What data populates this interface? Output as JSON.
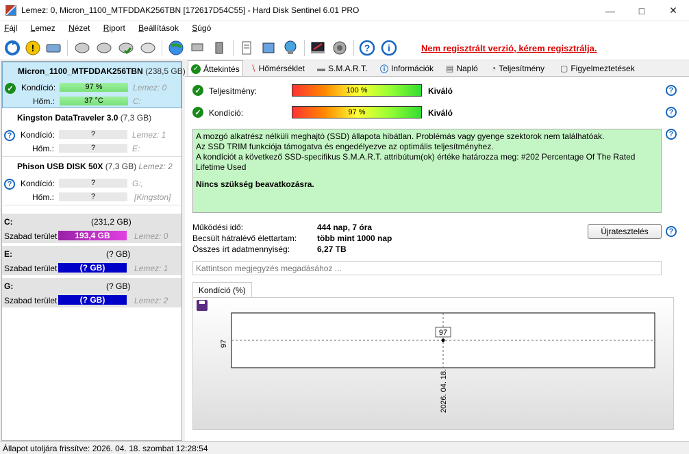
{
  "window": {
    "title": "Lemez: 0, Micron_1100_MTFDDAK256TBN [172617D54C55]  -  Hard Disk Sentinel 6.01 PRO"
  },
  "menu": [
    "Fájl",
    "Lemez",
    "Nézet",
    "Riport",
    "Beállítások",
    "Súgó"
  ],
  "toolbar": {
    "register_link": "Nem regisztrált verzió, kérem regisztrálja."
  },
  "disks": [
    {
      "name": "Micron_1100_MTFDDAK256TBN",
      "size": "(238,5 GB)",
      "condition_label": "Kondíció:",
      "condition": "97 %",
      "condition_ghost": "Lemez: 0",
      "temp_label": "Hőm.:",
      "temp": "37 °C",
      "temp_ghost": "C:"
    },
    {
      "name": "Kingston DataTraveler 3.0",
      "size": "(7,3 GB)",
      "condition_label": "Kondíció:",
      "condition": "?",
      "condition_ghost": "Lemez: 1",
      "temp_label": "Hőm.:",
      "temp": "?",
      "temp_ghost": "E:"
    },
    {
      "name": "Phison  USB DISK 50X",
      "size": "(7,3 GB)",
      "disk_ghost": "Lemez: 2",
      "condition_label": "Kondíció:",
      "condition": "?",
      "condition_ghost": "G:,",
      "temp_label": "Hőm.:",
      "temp": "?",
      "temp_ghost": "[Kingston]"
    }
  ],
  "volumes": [
    {
      "letter": "C:",
      "size": "(231,2 GB)",
      "free_label": "Szabad terület",
      "free": "193,4 GB",
      "ghost": "Lemez: 0"
    },
    {
      "letter": "E:",
      "size": "(? GB)",
      "free_label": "Szabad terület",
      "free": "(? GB)",
      "ghost": "Lemez: 1"
    },
    {
      "letter": "G:",
      "size": "(? GB)",
      "free_label": "Szabad terület",
      "free": "(? GB)",
      "ghost": "Lemez: 2"
    }
  ],
  "tabs": [
    "Áttekintés",
    "Hőmérséklet",
    "S.M.A.R.T.",
    "Információk",
    "Napló",
    "Teljesítmény",
    "Figyelmeztetések"
  ],
  "overview": {
    "performance_label": "Teljesítmény:",
    "performance_value": "100 %",
    "performance_rating": "Kiváló",
    "condition_label": "Kondíció:",
    "condition_value": "97 %",
    "condition_rating": "Kiváló",
    "status_lines": [
      "A mozgó alkatrész nélküli meghajtó (SSD) állapota hibátlan. Problémás vagy gyenge szektorok nem találhatóak.",
      "Az SSD TRIM funkciója támogatva és engedélyezve az optimális teljesítményhez.",
      "A kondíciót a következő SSD-specifikus S.M.A.R.T. attribútum(ok) értéke határozza meg:  #202 Percentage Of The Rated Lifetime Used"
    ],
    "status_action": "Nincs szükség beavatkozásra.",
    "uptime_label": "Működési idő:",
    "uptime_value": "444 nap, 7 óra",
    "lifetime_label": "Becsült hátralévő élettartam:",
    "lifetime_value": "több mint 1000 nap",
    "written_label": "Összes írt adatmennyiség:",
    "written_value": "6,27 TB",
    "reset_button": "Újratesztelés",
    "comment_placeholder": "Kattintson megjegyzés megadásához ..."
  },
  "chart_data": {
    "type": "line",
    "title": "Kondíció  (%)",
    "x": [
      "2026. 04. 18."
    ],
    "series": [
      {
        "values": [
          97
        ]
      }
    ],
    "ytick": "97",
    "point_label": "97"
  },
  "statusbar": "Állapot utoljára frissítve: 2026. 04. 18. szombat 12:28:54"
}
